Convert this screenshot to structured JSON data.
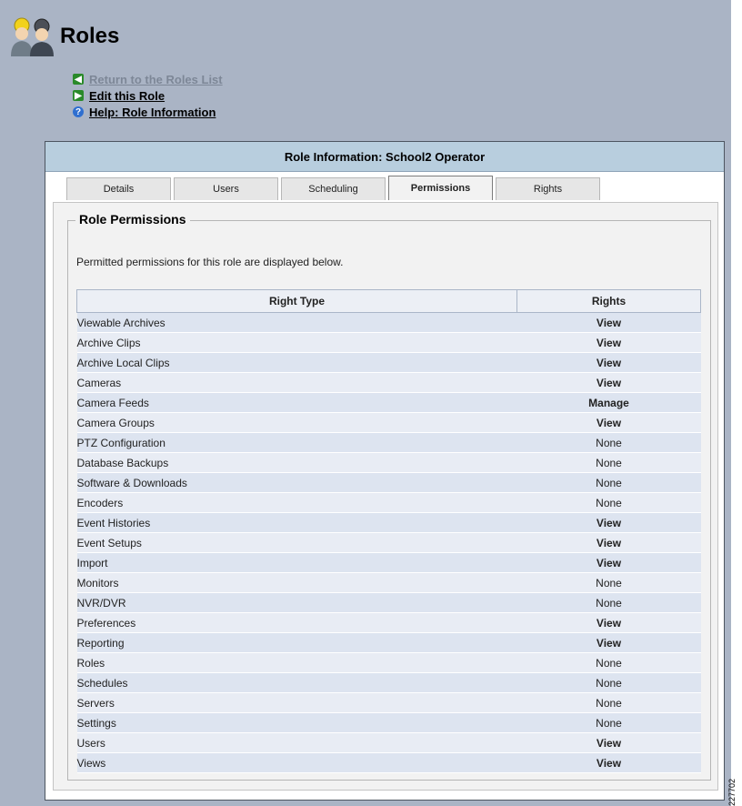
{
  "page": {
    "title": "Roles"
  },
  "links": {
    "return": "Return to the Roles List",
    "edit": "Edit this Role",
    "help": "Help: Role Information"
  },
  "panel": {
    "title": "Role Information: School2 Operator"
  },
  "tabs": [
    {
      "label": "Details",
      "active": false
    },
    {
      "label": "Users",
      "active": false
    },
    {
      "label": "Scheduling",
      "active": false
    },
    {
      "label": "Permissions",
      "active": true
    },
    {
      "label": "Rights",
      "active": false
    }
  ],
  "section": {
    "legend": "Role Permissions",
    "intro": "Permitted permissions for this role are displayed below."
  },
  "table": {
    "headers": [
      "Right Type",
      "Rights"
    ],
    "rows": [
      {
        "type": "Viewable Archives",
        "right": "View"
      },
      {
        "type": "Archive Clips",
        "right": "View"
      },
      {
        "type": "Archive Local Clips",
        "right": "View"
      },
      {
        "type": "Cameras",
        "right": "View"
      },
      {
        "type": "Camera Feeds",
        "right": "Manage"
      },
      {
        "type": "Camera Groups",
        "right": "View"
      },
      {
        "type": "PTZ Configuration",
        "right": "None"
      },
      {
        "type": "Database Backups",
        "right": "None"
      },
      {
        "type": "Software & Downloads",
        "right": "None"
      },
      {
        "type": "Encoders",
        "right": "None"
      },
      {
        "type": "Event Histories",
        "right": "View"
      },
      {
        "type": "Event Setups",
        "right": "View"
      },
      {
        "type": "Import",
        "right": "View"
      },
      {
        "type": "Monitors",
        "right": "None"
      },
      {
        "type": "NVR/DVR",
        "right": "None"
      },
      {
        "type": "Preferences",
        "right": "View"
      },
      {
        "type": "Reporting",
        "right": "View"
      },
      {
        "type": "Roles",
        "right": "None"
      },
      {
        "type": "Schedules",
        "right": "None"
      },
      {
        "type": "Servers",
        "right": "None"
      },
      {
        "type": "Settings",
        "right": "None"
      },
      {
        "type": "Users",
        "right": "View"
      },
      {
        "type": "Views",
        "right": "View"
      }
    ]
  },
  "figure_id": "227702",
  "icons": {
    "roles": "users-group-icon",
    "back": "arrow-left-icon",
    "edit": "arrow-right-icon",
    "help": "help-icon"
  }
}
